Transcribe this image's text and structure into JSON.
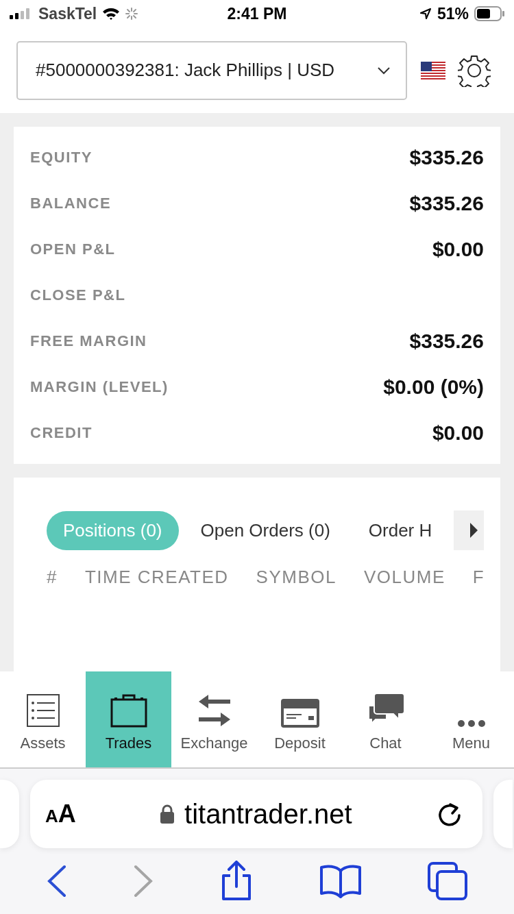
{
  "status_bar": {
    "carrier": "SaskTel",
    "time": "2:41 PM",
    "battery": "51%"
  },
  "account_selector": {
    "value": "#5000000392381: Jack Phillips | USD"
  },
  "summary": [
    {
      "label": "EQUITY",
      "value": "$335.26"
    },
    {
      "label": "BALANCE",
      "value": "$335.26"
    },
    {
      "label": "OPEN P&L",
      "value": "$0.00"
    },
    {
      "label": "CLOSE P&L"
    },
    {
      "label": "FREE MARGIN",
      "value": "$335.26"
    },
    {
      "label": "MARGIN (LEVEL)",
      "value": "$0.00 (0%)"
    },
    {
      "label": "CREDIT",
      "value": "$0.00"
    }
  ],
  "tabs": [
    {
      "label": "Positions (0)",
      "selected": true
    },
    {
      "label": "Open Orders (0)",
      "selected": false
    },
    {
      "label": "Order H",
      "selected": false
    }
  ],
  "table": {
    "columns": [
      "#",
      "TIME CREATED",
      "SYMBOL",
      "VOLUME",
      "F"
    ]
  },
  "nav": [
    {
      "kind": "list",
      "label": "Assets",
      "selected": false
    },
    {
      "kind": "briefcase",
      "label": "Trades",
      "selected": true
    },
    {
      "kind": "exchange",
      "label": "Exchange",
      "selected": false
    },
    {
      "kind": "card",
      "label": "Deposit",
      "selected": false
    },
    {
      "kind": "chat",
      "label": "Chat",
      "selected": false
    },
    {
      "kind": "dots",
      "label": "Menu",
      "selected": false
    }
  ],
  "browser": {
    "text_size": "AA",
    "url": "titantrader.net",
    "back_disabled": false,
    "forward_disabled": true
  }
}
